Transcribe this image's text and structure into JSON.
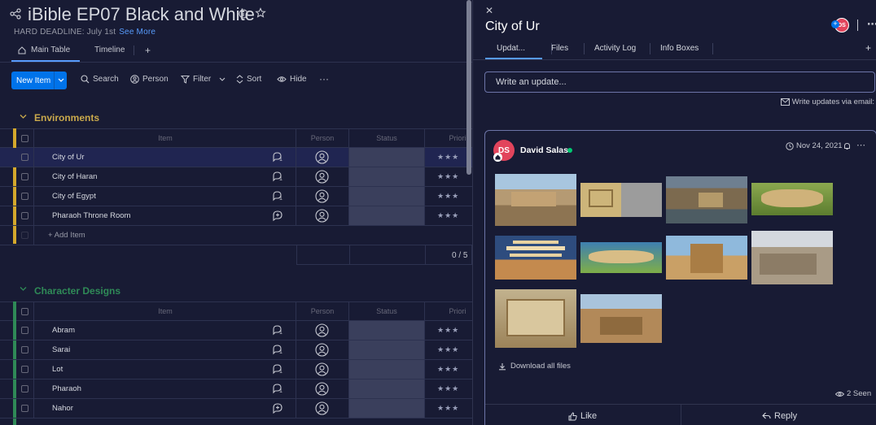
{
  "board": {
    "title": "iBible EP07 Black and White",
    "deadline_text": "HARD DEADLINE: July 1st",
    "see_more": "See More",
    "tabs": [
      {
        "label": "Main Table"
      },
      {
        "label": "Timeline"
      },
      {
        "label": "+"
      }
    ],
    "toolbar": {
      "new_item": "New Item",
      "search": "Search",
      "person": "Person",
      "filter": "Filter",
      "sort": "Sort",
      "hide": "Hide",
      "more": "···"
    },
    "columns": {
      "item": "Item",
      "person": "Person",
      "status": "Status",
      "priority": "Priori"
    },
    "groups": [
      {
        "title": "Environments",
        "color": "#d4a82c",
        "title_color": "#c9a94c",
        "rows": [
          {
            "name": "City of Ur",
            "updates": "1",
            "stars": "★★★"
          },
          {
            "name": "City of Haran",
            "updates": "1",
            "stars": "★★★"
          },
          {
            "name": "City of Egypt",
            "updates": "1",
            "stars": "★★★"
          },
          {
            "name": "Pharaoh Throne Room",
            "updates": "",
            "stars": "★★★"
          }
        ],
        "add_item": "+ Add Item",
        "summary": "0 / 5"
      },
      {
        "title": "Character Designs",
        "color": "#2f8a57",
        "title_color": "#2f8a57",
        "rows": [
          {
            "name": "Abram",
            "updates": "1",
            "stars": "★★★"
          },
          {
            "name": "Sarai",
            "updates": "1",
            "stars": "★★★"
          },
          {
            "name": "Lot",
            "updates": "1",
            "stars": "★★★"
          },
          {
            "name": "Pharaoh",
            "updates": "1",
            "stars": "★★★"
          },
          {
            "name": "Nahor",
            "updates": "",
            "stars": "★★★"
          }
        ]
      }
    ]
  },
  "panel": {
    "close": "✕",
    "title": "City of Ur",
    "avatar_initials": "DS",
    "tabs": [
      {
        "label": "Updat..."
      },
      {
        "label": "Files"
      },
      {
        "label": "Activity Log"
      },
      {
        "label": "Info Boxes"
      },
      {
        "label": "+"
      }
    ],
    "write_placeholder": "Write an update...",
    "email_link": "Write updates via email:",
    "post": {
      "avatar_initials": "DS",
      "author": "David Salas",
      "date": "Nov 24, 2021",
      "download": "Download all files",
      "seen": "2 Seen",
      "like": "Like",
      "reply": "Reply"
    }
  },
  "colors": {
    "accent": "#0073ea",
    "bg": "#181b34",
    "selected_row": "#202551"
  }
}
